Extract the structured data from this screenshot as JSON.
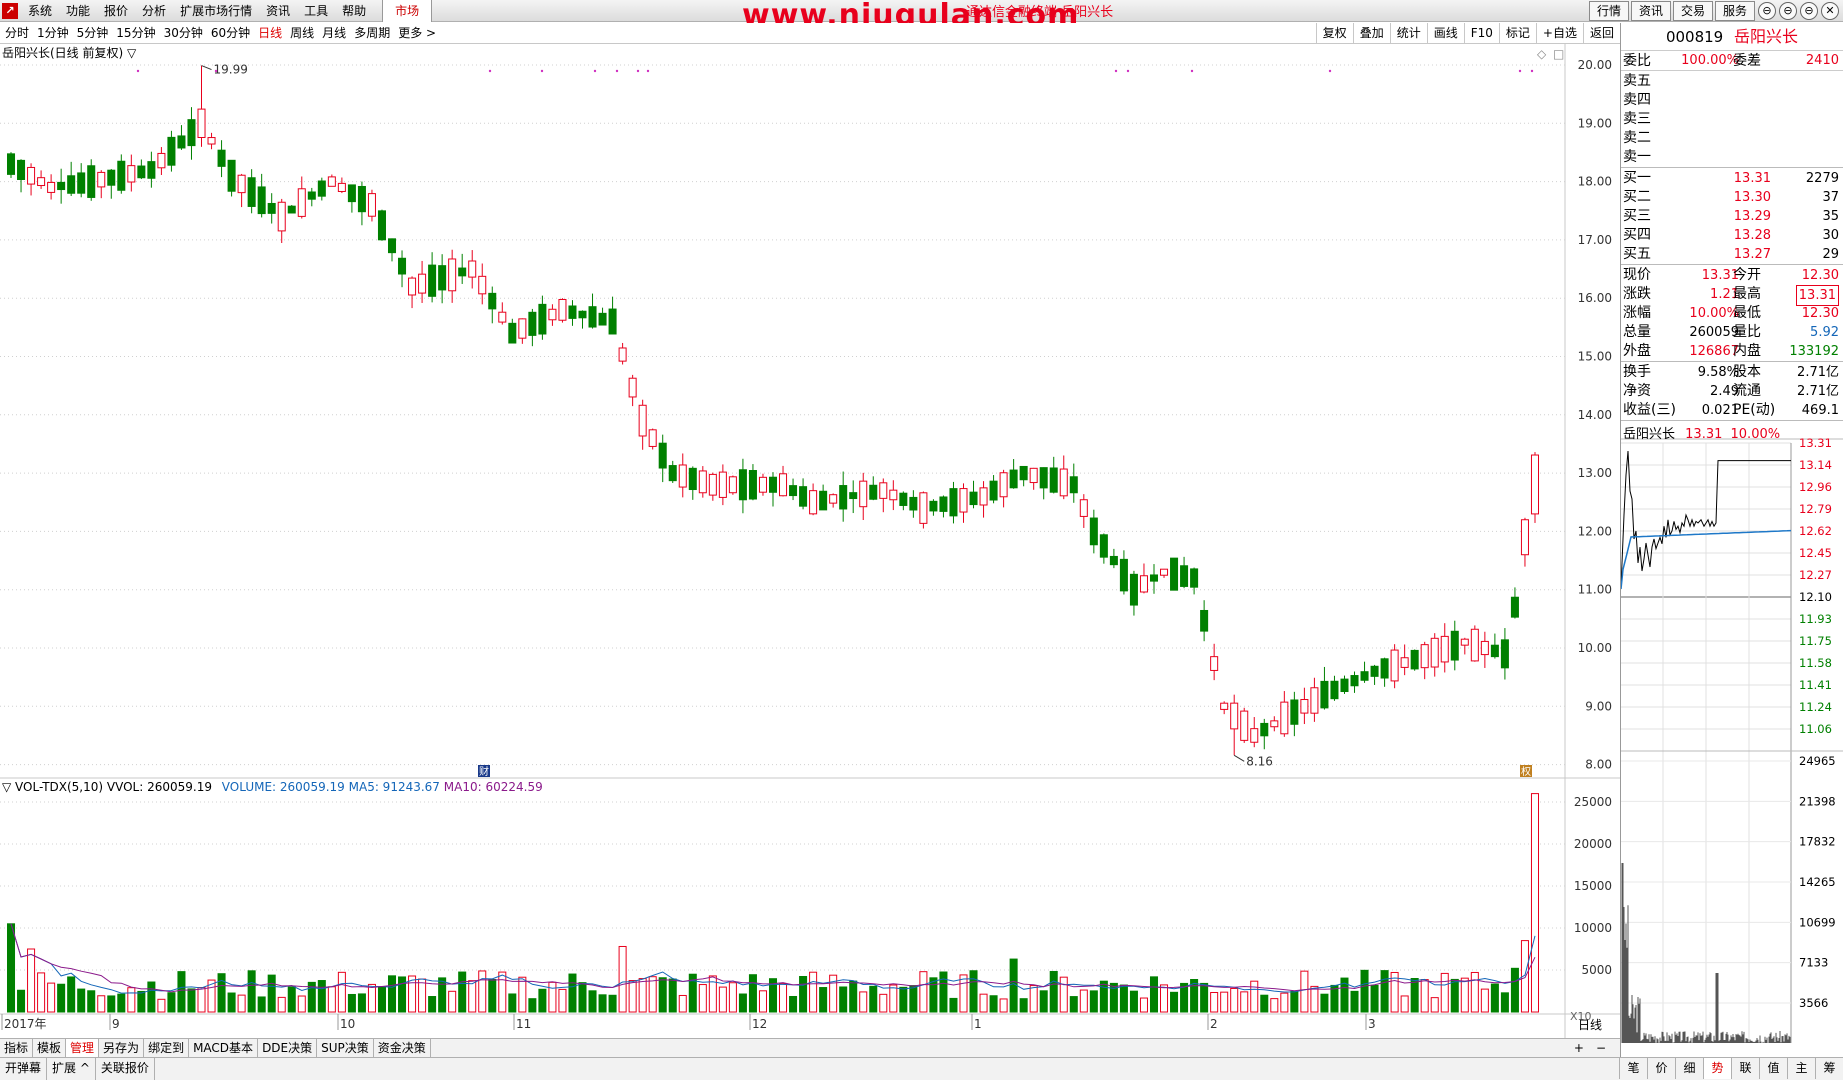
{
  "menu": {
    "logo": "↗",
    "items": [
      "系统",
      "功能",
      "报价",
      "分析",
      "扩展市场行情",
      "资讯",
      "工具",
      "帮助"
    ],
    "market": "市场",
    "watermark": "www.niugulan.com",
    "watermark_sub": "通达信金融终端 岳阳兴长",
    "right_buttons": [
      "行情",
      "资讯",
      "交易",
      "服务"
    ],
    "window_controls": [
      "⊖",
      "⊖",
      "⊖",
      "✕"
    ]
  },
  "periods": {
    "items": [
      "分时",
      "1分钟",
      "5分钟",
      "15分钟",
      "30分钟",
      "60分钟",
      "日线",
      "周线",
      "月线",
      "多周期",
      "更多 >"
    ],
    "active": "日线",
    "tools": [
      "复权",
      "叠加",
      "统计",
      "画线",
      "F10",
      "标记",
      "+自选",
      "返回"
    ]
  },
  "chart": {
    "title": "岳阳兴长(日线 前复权) ▽",
    "max_label": "19.99",
    "min_label": "8.16",
    "fin_icon": "财",
    "rest_icon": "权",
    "price_ticks": [
      "20.00",
      "19.00",
      "18.00",
      "17.00",
      "16.00",
      "15.00",
      "14.00",
      "13.00",
      "12.00",
      "11.00",
      "10.00",
      "9.00",
      "8.00"
    ],
    "vol_ticks": [
      "25000",
      "20000",
      "15000",
      "10000",
      "5000"
    ],
    "x_scale": "X10",
    "date_labels": [
      "2017年",
      "9",
      "10",
      "11",
      "12",
      "1",
      "2",
      "3"
    ],
    "bottom_right": "日线",
    "corner_icons": [
      "◇",
      "□"
    ],
    "colors": {
      "up": "#e8001c",
      "down": "#008000",
      "ma5": "#1466b8",
      "ma10": "#8b1a8b"
    }
  },
  "vol_header": {
    "name": "▽ VOL-TDX(5,10)  VVOL: 260059.19",
    "volume": "VOLUME: 260059.19",
    "ma5": "MA5: 91243.67",
    "ma10": "MA10: 60224.59"
  },
  "tabs": {
    "row1": [
      "指标",
      "模板",
      "管理",
      "另存为",
      "绑定到",
      "MACD基本",
      "DDE决策",
      "SUP决策",
      "资金决策"
    ],
    "row1_active": "管理",
    "pm": [
      "+",
      "−"
    ],
    "row2": [
      "开弹幕",
      "扩展 ^",
      "关联报价"
    ],
    "right": [
      "笔",
      "价",
      "细",
      "势",
      "联",
      "值",
      "主",
      "筹"
    ],
    "right_active": "势"
  },
  "quote": {
    "code": "000819",
    "name": "岳阳兴长",
    "weibi_label": "委比",
    "weibi": "100.00%",
    "weicha_label": "委差",
    "weicha": "2410",
    "asks": [
      "卖五",
      "卖四",
      "卖三",
      "卖二",
      "卖一"
    ],
    "bids": [
      {
        "label": "买一",
        "price": "13.31",
        "vol": "2279"
      },
      {
        "label": "买二",
        "price": "13.30",
        "vol": "37"
      },
      {
        "label": "买三",
        "price": "13.29",
        "vol": "35"
      },
      {
        "label": "买四",
        "price": "13.28",
        "vol": "30"
      },
      {
        "label": "买五",
        "price": "13.27",
        "vol": "29"
      }
    ],
    "info": [
      {
        "l1": "现价",
        "v1": "13.31",
        "c1": "red",
        "l2": "今开",
        "v2": "12.30",
        "c2": "red"
      },
      {
        "l1": "涨跌",
        "v1": "1.21",
        "c1": "red",
        "l2": "最高",
        "v2": "13.31",
        "c2": "red",
        "box2": true
      },
      {
        "l1": "涨幅",
        "v1": "10.00%",
        "c1": "red",
        "l2": "最低",
        "v2": "12.30",
        "c2": "red"
      },
      {
        "l1": "总量",
        "v1": "260059",
        "c1": "",
        "l2": "量比",
        "v2": "5.92",
        "c2": "blue"
      },
      {
        "l1": "外盘",
        "v1": "126867",
        "c1": "red",
        "l2": "内盘",
        "v2": "133192",
        "c2": "green"
      }
    ],
    "info2": [
      {
        "l1": "换手",
        "v1": "9.58%",
        "l2": "股本",
        "v2": "2.71亿"
      },
      {
        "l1": "净资",
        "v1": "2.49",
        "l2": "流通",
        "v2": "2.71亿"
      },
      {
        "l1": "收益(三)",
        "v1": "0.021",
        "l2": "PE(动)",
        "v2": "469.1"
      }
    ],
    "mini": {
      "title": "岳阳兴长",
      "price": "13.31",
      "pct": "10.00%",
      "price_ticks": [
        "13.31",
        "13.14",
        "12.96",
        "12.79",
        "12.62",
        "12.45",
        "12.27",
        "12.10",
        "11.93",
        "11.75",
        "11.58",
        "11.41",
        "11.24",
        "11.06"
      ],
      "vol_ticks": [
        "24965",
        "21398",
        "17832",
        "14265",
        "10699",
        "7133",
        "3566"
      ]
    }
  }
}
